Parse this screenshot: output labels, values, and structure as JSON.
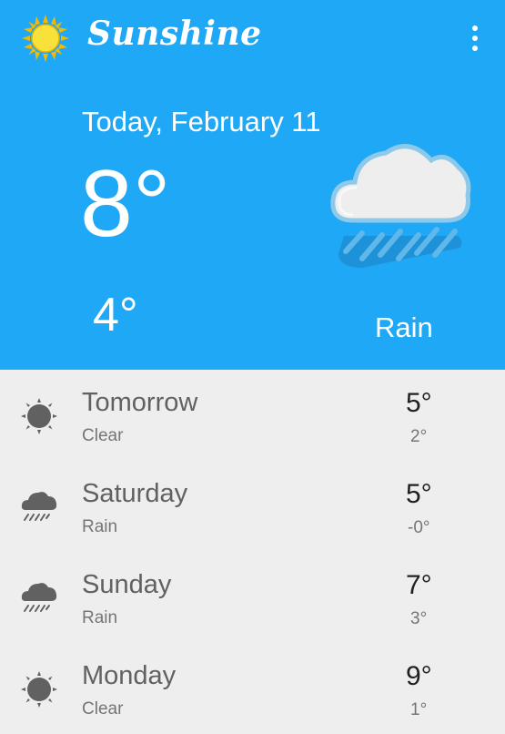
{
  "app": {
    "title": "Sunshine",
    "logo_icon": "sun-icon",
    "menu_icon": "overflow-menu-icon"
  },
  "colors": {
    "primary": "#1fa8f5",
    "background": "#eeeeee",
    "icon_gray": "#616161"
  },
  "today": {
    "date": "Today, February 11",
    "high": "8°",
    "low": "4°",
    "description": "Rain",
    "icon": "rain-cloud-icon"
  },
  "forecast": [
    {
      "day": "Tomorrow",
      "description": "Clear",
      "high": "5°",
      "low": "2°",
      "icon": "clear-sun-icon"
    },
    {
      "day": "Saturday",
      "description": "Rain",
      "high": "5°",
      "low": "-0°",
      "icon": "rain-icon"
    },
    {
      "day": "Sunday",
      "description": "Rain",
      "high": "7°",
      "low": "3°",
      "icon": "rain-icon"
    },
    {
      "day": "Monday",
      "description": "Clear",
      "high": "9°",
      "low": "1°",
      "icon": "clear-sun-icon"
    }
  ]
}
